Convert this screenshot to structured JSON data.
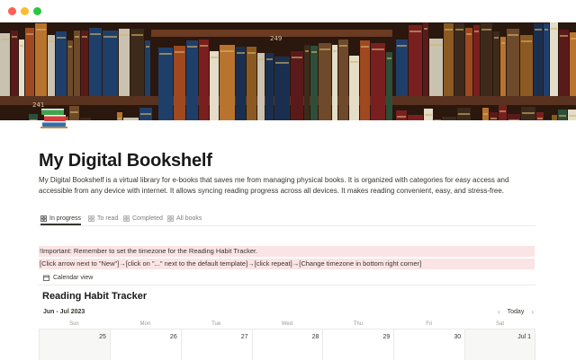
{
  "window": {
    "controls": [
      "close",
      "minimize",
      "zoom"
    ]
  },
  "page": {
    "icon": "books-icon",
    "title": "My Digital Bookshelf",
    "description": "My Digital Bookshelf is a virtual library for e-books that saves me from managing physical books. It is organized with categories for easy access and accessible from any device with internet. It allows syncing reading progress across all devices. It makes reading convenient, easy, and stress-free."
  },
  "cover": {
    "shelf_labels": [
      "249",
      "241"
    ]
  },
  "tabs": [
    {
      "label": "In progress",
      "active": true
    },
    {
      "label": "To read",
      "active": false
    },
    {
      "label": "Completed",
      "active": false
    },
    {
      "label": "All books",
      "active": false
    }
  ],
  "callouts": [
    "!Important: Remember to set the timezone for the Reading Habit Tracker.",
    "[Click arrow next to \"New\"]→[click on \"...\" next to the default template]→[click repeat]→[Change timezone in bottom right corner]"
  ],
  "calendar": {
    "view_label": "Calendar view",
    "title": "Reading Habit Tracker",
    "month": "Jun - Jul 2023",
    "today_label": "Today",
    "weekdays": [
      "Sun",
      "Mon",
      "Tue",
      "Wed",
      "Thu",
      "Fri",
      "Sat"
    ],
    "days": [
      "25",
      "26",
      "27",
      "28",
      "29",
      "30",
      "Jul 1"
    ]
  },
  "colors": {
    "callout_bg": "#fbe4e4",
    "accent_text": "#37352f"
  }
}
